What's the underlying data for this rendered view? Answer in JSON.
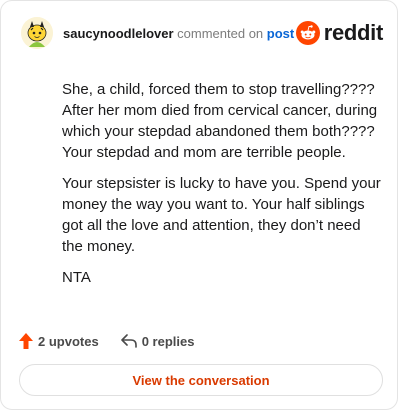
{
  "header": {
    "author": "saucynoodlelover",
    "action": "commented on",
    "post_link": "post",
    "brand": "reddit",
    "avatar_icon": "snoo-avatar-icon"
  },
  "comment": {
    "paragraphs": [
      "She, a child, forced them to stop travelling???? After her mom died from cervical cancer, during which your stepdad abandoned them both???? Your stepdad and mom are terrible people.",
      "Your stepsister is lucky to have you. Spend your money the way you want to. Your half siblings got all the love and attention, they don’t need the money.",
      "NTA"
    ]
  },
  "stats": {
    "upvotes": "2 upvotes",
    "replies": "0 replies",
    "upvote_icon": "upvote-arrow-icon",
    "reply_icon": "reply-arrow-icon"
  },
  "cta": {
    "label": "View the conversation"
  },
  "colors": {
    "brand": "#ff4500",
    "link": "#0a66d6",
    "cta_text": "#d93a00",
    "upvote": "#ff4500"
  }
}
